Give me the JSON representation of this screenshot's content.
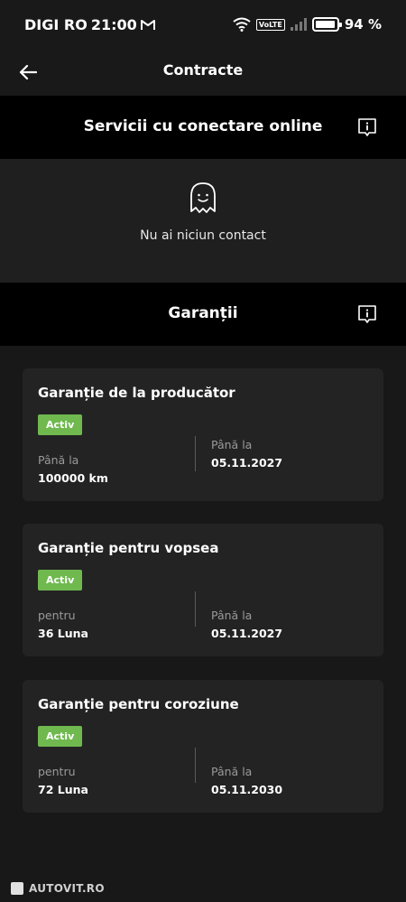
{
  "status_bar": {
    "carrier": "DIGI RO",
    "time": "21:00",
    "volte": "VoLTE",
    "battery_pct": "94 %",
    "battery_level": 0.94
  },
  "header": {
    "title": "Contracte"
  },
  "online_services": {
    "title": "Servicii cu conectare online",
    "empty_text": "Nu ai niciun contact"
  },
  "warranties": {
    "title": "Garanții",
    "cards": [
      {
        "title": "Garanție de la producător",
        "status": "Activ",
        "left_label": "Până la",
        "left_value": "100000 km",
        "right_label": "Până la",
        "right_value": "05.11.2027"
      },
      {
        "title": "Garanție pentru vopsea",
        "status": "Activ",
        "left_label": "pentru",
        "left_value": "36 Luna",
        "right_label": "Până la",
        "right_value": "05.11.2027"
      },
      {
        "title": "Garanție pentru coroziune",
        "status": "Activ",
        "left_label": "pentru",
        "left_value": "72 Luna",
        "right_label": "Până la",
        "right_value": "05.11.2030"
      }
    ]
  },
  "watermark": "AUTOVIT.RO",
  "colors": {
    "background": "#181818",
    "section_header": "#000000",
    "card": "#232323",
    "badge": "#6fb94f"
  }
}
